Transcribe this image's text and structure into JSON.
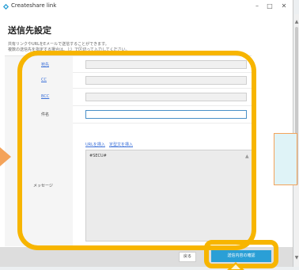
{
  "window": {
    "title": "Createshare link",
    "controls": {
      "minimize": "–",
      "maximize": "□",
      "close": "✕"
    }
  },
  "page": {
    "heading": "送信先設定",
    "desc_line1": "共有リンクやURLをEメールで送信することができます。",
    "desc_line2": "複数の送信先を指定する場合は、（;）で区切って入力してください。"
  },
  "form": {
    "to_label": "宛先",
    "cc_label": "CC",
    "bcc_label": "BCC",
    "subject_label": "件名",
    "message_label": "メッセージ",
    "insert_url_link": "URLを挿入",
    "insert_sentence_link": "定型文を挿入",
    "message_value": "#SECU#"
  },
  "footer": {
    "back_label": "戻る",
    "confirm_label": "送信内容の確認"
  },
  "colors": {
    "highlight": "#f7b500",
    "accent": "#2a9fd6",
    "link": "#3a6fd8"
  },
  "icons": [
    "app-logo-icon",
    "minimize-icon",
    "maximize-icon",
    "close-icon",
    "scroll-up-icon",
    "scroll-down-icon"
  ]
}
